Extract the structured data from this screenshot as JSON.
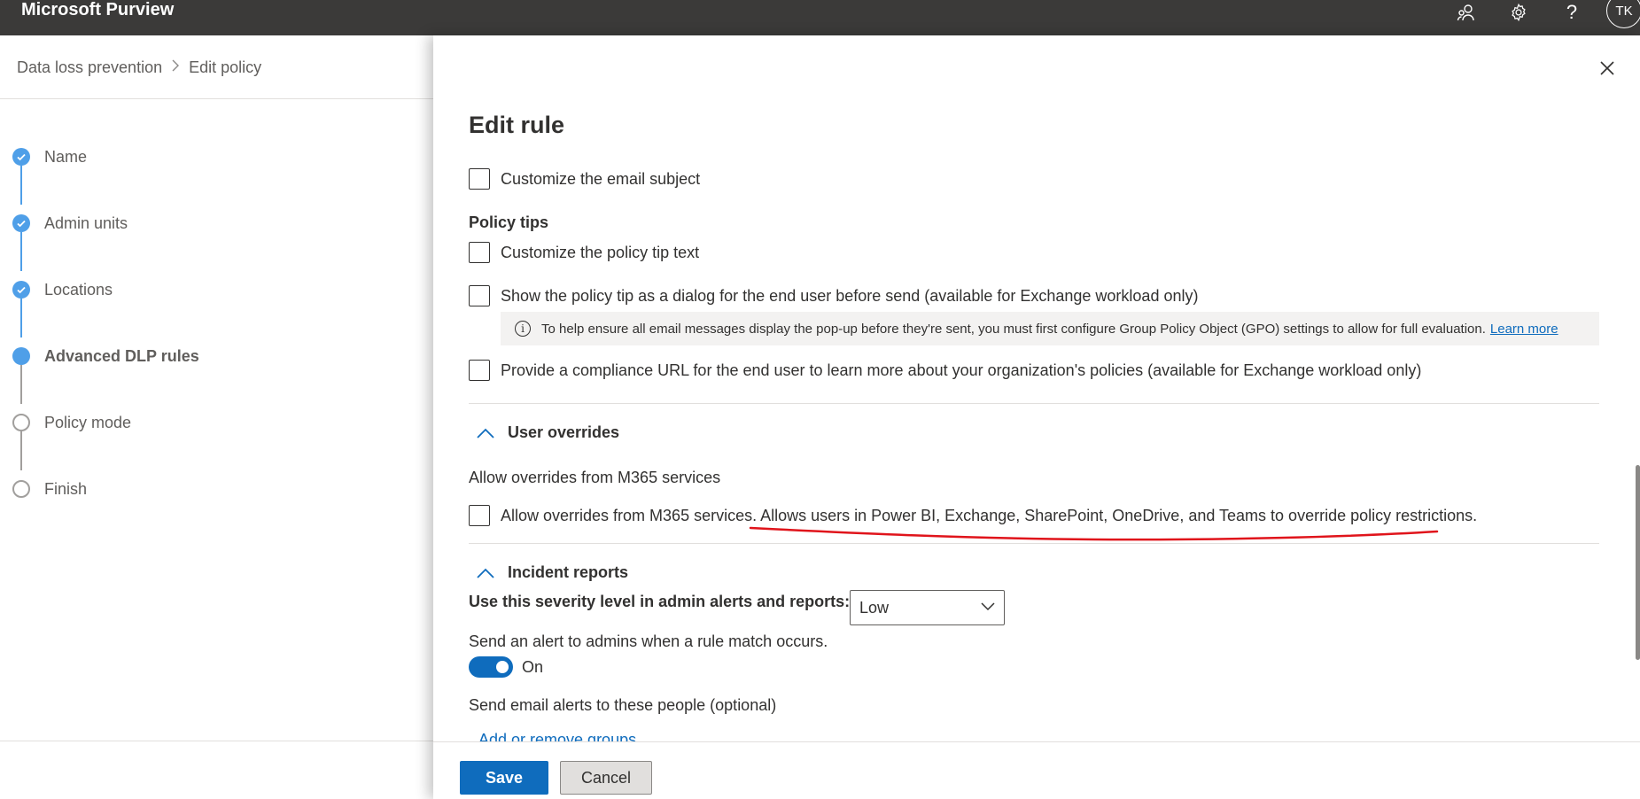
{
  "app": {
    "title": "Microsoft Purview",
    "avatar_initials": "TK",
    "icons": [
      "people-icon",
      "gear-icon",
      "help-icon"
    ]
  },
  "breadcrumb": {
    "items": [
      "Data loss prevention",
      "Edit policy"
    ],
    "separator": ">"
  },
  "steps": [
    {
      "label": "Name",
      "state": "done"
    },
    {
      "label": "Admin units",
      "state": "done"
    },
    {
      "label": "Locations",
      "state": "done"
    },
    {
      "label": "Advanced DLP rules",
      "state": "current"
    },
    {
      "label": "Policy mode",
      "state": "todo"
    },
    {
      "label": "Finish",
      "state": "todo"
    }
  ],
  "panel": {
    "title": "Edit rule",
    "customize_subject": "Customize the email subject",
    "policy_tips_heading": "Policy tips",
    "customize_tip": "Customize the policy tip text",
    "show_dialog": "Show the policy tip as a dialog for the end user before send (available for Exchange workload only)",
    "info_text": "To help ensure all email messages display the pop-up before they're sent, you must first configure Group Policy Object (GPO) settings to allow for full evaluation.",
    "info_link": "Learn more",
    "compliance_url": "Provide a compliance URL for the end user to learn more about your organization's policies (available for Exchange workload only)",
    "user_overrides_heading": "User overrides",
    "allow_overrides_label": "Allow overrides from M365 services",
    "allow_overrides_checkbox": "Allow overrides from M365 services. Allows users in Power BI, Exchange, SharePoint, OneDrive, and Teams to override policy restrictions.",
    "incident_reports_heading": "Incident reports",
    "severity_label": "Use this severity level in admin alerts and reports:",
    "severity_value": "Low",
    "alert_label": "Send an alert to admins when a rule match occurs.",
    "toggle_state": "On",
    "email_alerts_label": "Send email alerts to these people (optional)",
    "add_groups_link": "Add or remove groups"
  },
  "footer": {
    "save": "Save",
    "cancel": "Cancel"
  },
  "colors": {
    "topbar": "#3b3a39",
    "accent": "#0f6cbd",
    "step_blue": "#4f9fe8",
    "annotation_red": "#e0141b"
  }
}
